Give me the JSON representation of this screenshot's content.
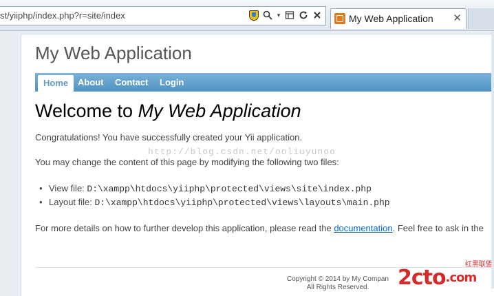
{
  "browser": {
    "url": "st/yiiphp/index.php?r=site/index",
    "tab_title": "My Web Application",
    "tab_close": "✕"
  },
  "site": {
    "header": "My Web Application",
    "menu": [
      {
        "label": "Home",
        "active": true
      },
      {
        "label": "About"
      },
      {
        "label": "Contact"
      },
      {
        "label": "Login"
      }
    ]
  },
  "content": {
    "heading_prefix": "Welcome to ",
    "heading_name": "My Web Application",
    "congrats": "Congratulations! You have successfully created your Yii application.",
    "change_text": "You may change the content of this page by modifying the following two files:",
    "files": [
      {
        "label": "View file: ",
        "path": "D:\\xampp\\htdocs\\yiiphp\\protected\\views\\site\\index.php"
      },
      {
        "label": "Layout file: ",
        "path": "D:\\xampp\\htdocs\\yiiphp\\protected\\views\\layouts\\main.php"
      }
    ],
    "more_prefix": "For more details on how to further develop this application, please read the ",
    "more_link": "documentation",
    "more_suffix": ". Feel free to ask in the"
  },
  "footer": {
    "copyright": "Copyright © 2014 by My Compan",
    "rights": "All Rights Reserved."
  },
  "watermark": "http://blog.csdn.net/ooliuyunoo",
  "logo": {
    "main": "2cto",
    "suffix": ".com",
    "side_top": "红黑联盟"
  },
  "colors": {
    "menu": "#4e93c4",
    "link": "#0066cc",
    "logo": "#d62b2b"
  }
}
